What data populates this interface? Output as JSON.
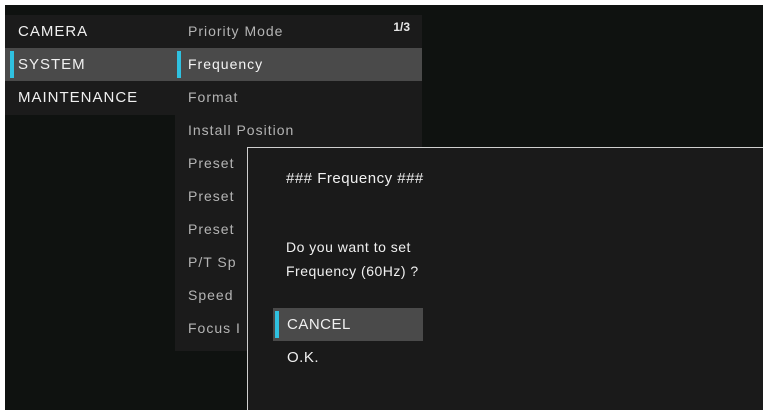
{
  "left_menu": {
    "items": [
      {
        "label": "CAMERA"
      },
      {
        "label": "SYSTEM"
      },
      {
        "label": "MAINTENANCE"
      }
    ],
    "selected_index": 1
  },
  "sub_menu": {
    "page_indicator": "1/3",
    "items": [
      {
        "label": "Priority Mode"
      },
      {
        "label": "Frequency"
      },
      {
        "label": "Format"
      },
      {
        "label": "Install Position"
      },
      {
        "label": "Preset"
      },
      {
        "label": "Preset"
      },
      {
        "label": "Preset"
      },
      {
        "label": "P/T Sp"
      },
      {
        "label": "Speed"
      },
      {
        "label": "Focus I"
      }
    ],
    "selected_index": 1
  },
  "dialog": {
    "title": "### Frequency ###",
    "question_line1": "Do you want to set",
    "question_line2": "Frequency (60Hz) ?",
    "buttons": [
      {
        "label": "CANCEL"
      },
      {
        "label": "O.K."
      }
    ],
    "selected_index": 0
  },
  "colors": {
    "accent": "#2fc1e0",
    "selected_bg": "#4a4a4a",
    "panel_bg": "#1b1b1b"
  }
}
